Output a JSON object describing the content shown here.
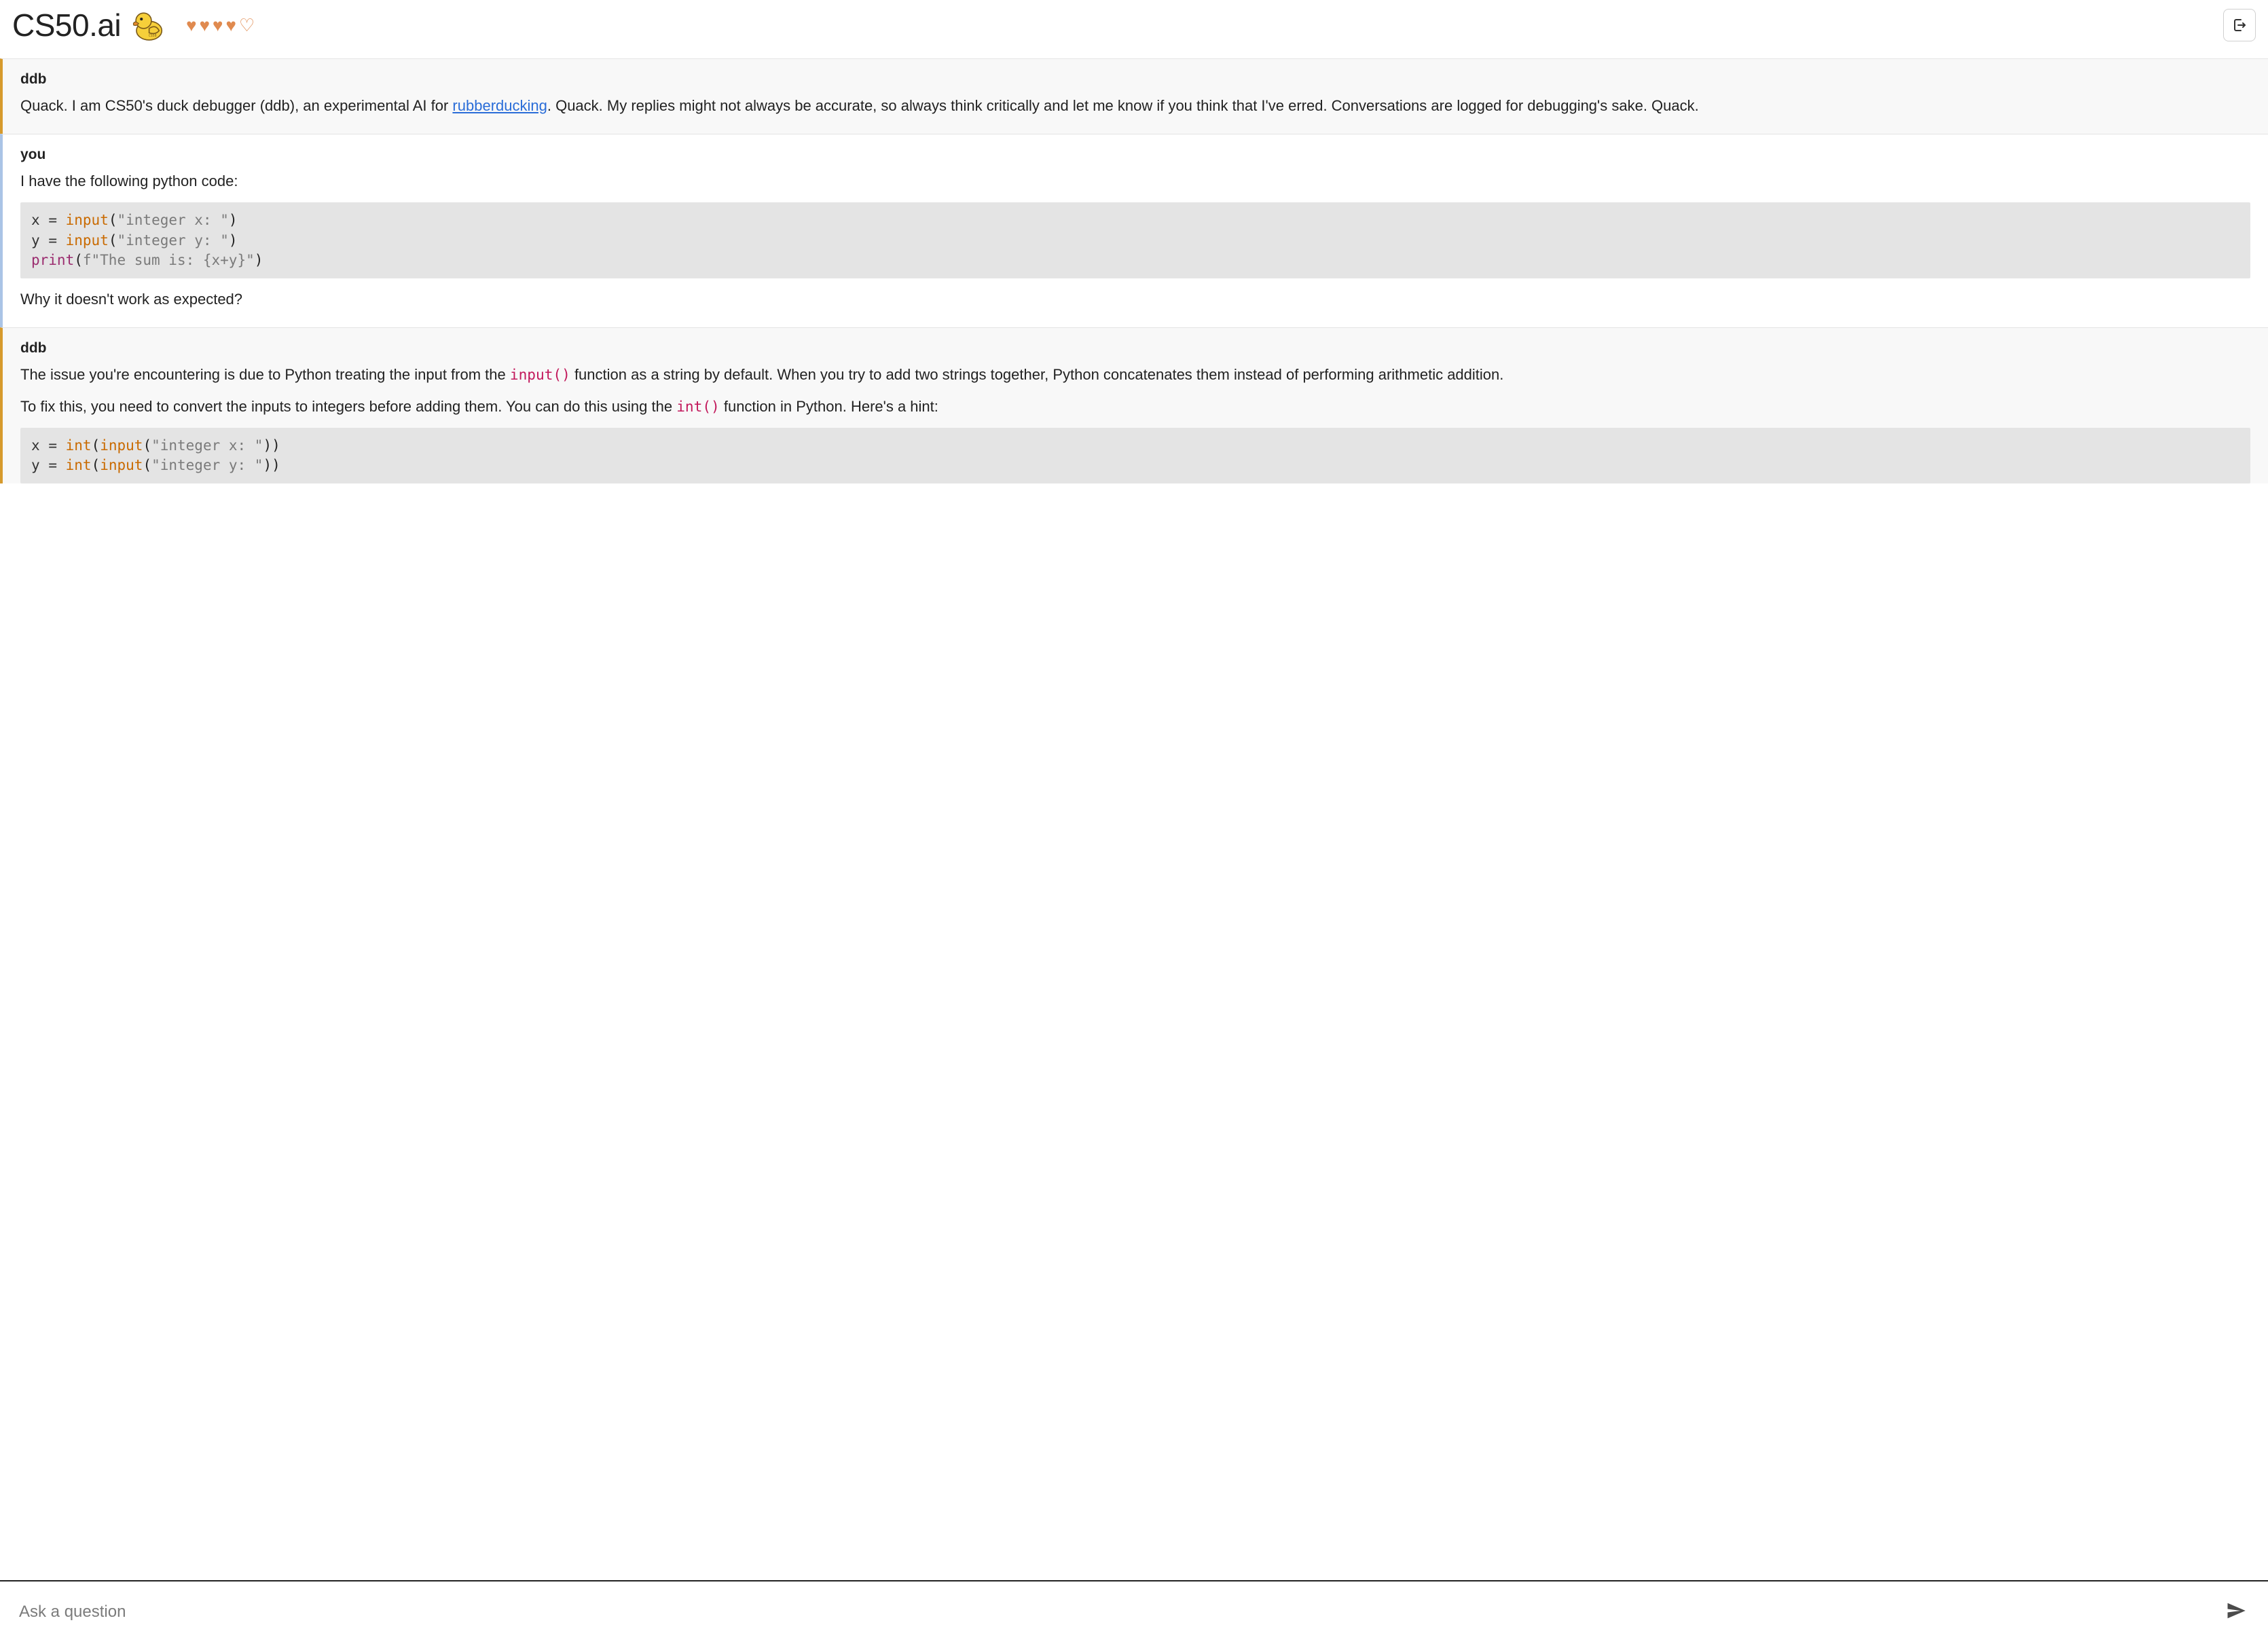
{
  "header": {
    "title": "CS50.ai",
    "hearts_full": 4,
    "hearts_total": 5
  },
  "messages": [
    {
      "kind": "ddb",
      "sender": "ddb",
      "intro_pre_link": "Quack. I am CS50's duck debugger (ddb), an experimental AI for ",
      "link_text": "rubberducking",
      "intro_post_link": ". Quack. My replies might not always be accurate, so always think critically and let me know if you think that I've erred. Conversations are logged for debugging's sake. Quack."
    },
    {
      "kind": "you",
      "sender": "you",
      "lead": "I have the following python code:",
      "code_lines": [
        {
          "v": "x",
          "fn": "input",
          "s": "\"integer x: \"",
          "tail": ")"
        },
        {
          "v": "y",
          "fn": "input",
          "s": "\"integer y: \"",
          "tail": ")"
        },
        {
          "print": true,
          "s": "f\"The sum is: {x+y}\"",
          "tail": ")"
        }
      ],
      "follow": "Why it doesn't work as expected?"
    },
    {
      "kind": "ddb",
      "sender": "ddb",
      "p1_pre": "The issue you're encountering is due to Python treating the input from the ",
      "p1_code": "input()",
      "p1_post": " function as a string by default. When you try to add two strings together, Python concatenates them instead of performing arithmetic addition.",
      "p2_pre": "To fix this, you need to convert the inputs to integers before adding them. You can do this using the ",
      "p2_code": "int()",
      "p2_post": " function in Python. Here's a hint:",
      "code_lines": [
        {
          "v": "x",
          "s": "\"integer x: \"",
          "tail": "))"
        },
        {
          "v": "y",
          "s": "\"integer y: \"",
          "tail": "))"
        }
      ]
    }
  ],
  "composer": {
    "placeholder": "Ask a question"
  }
}
